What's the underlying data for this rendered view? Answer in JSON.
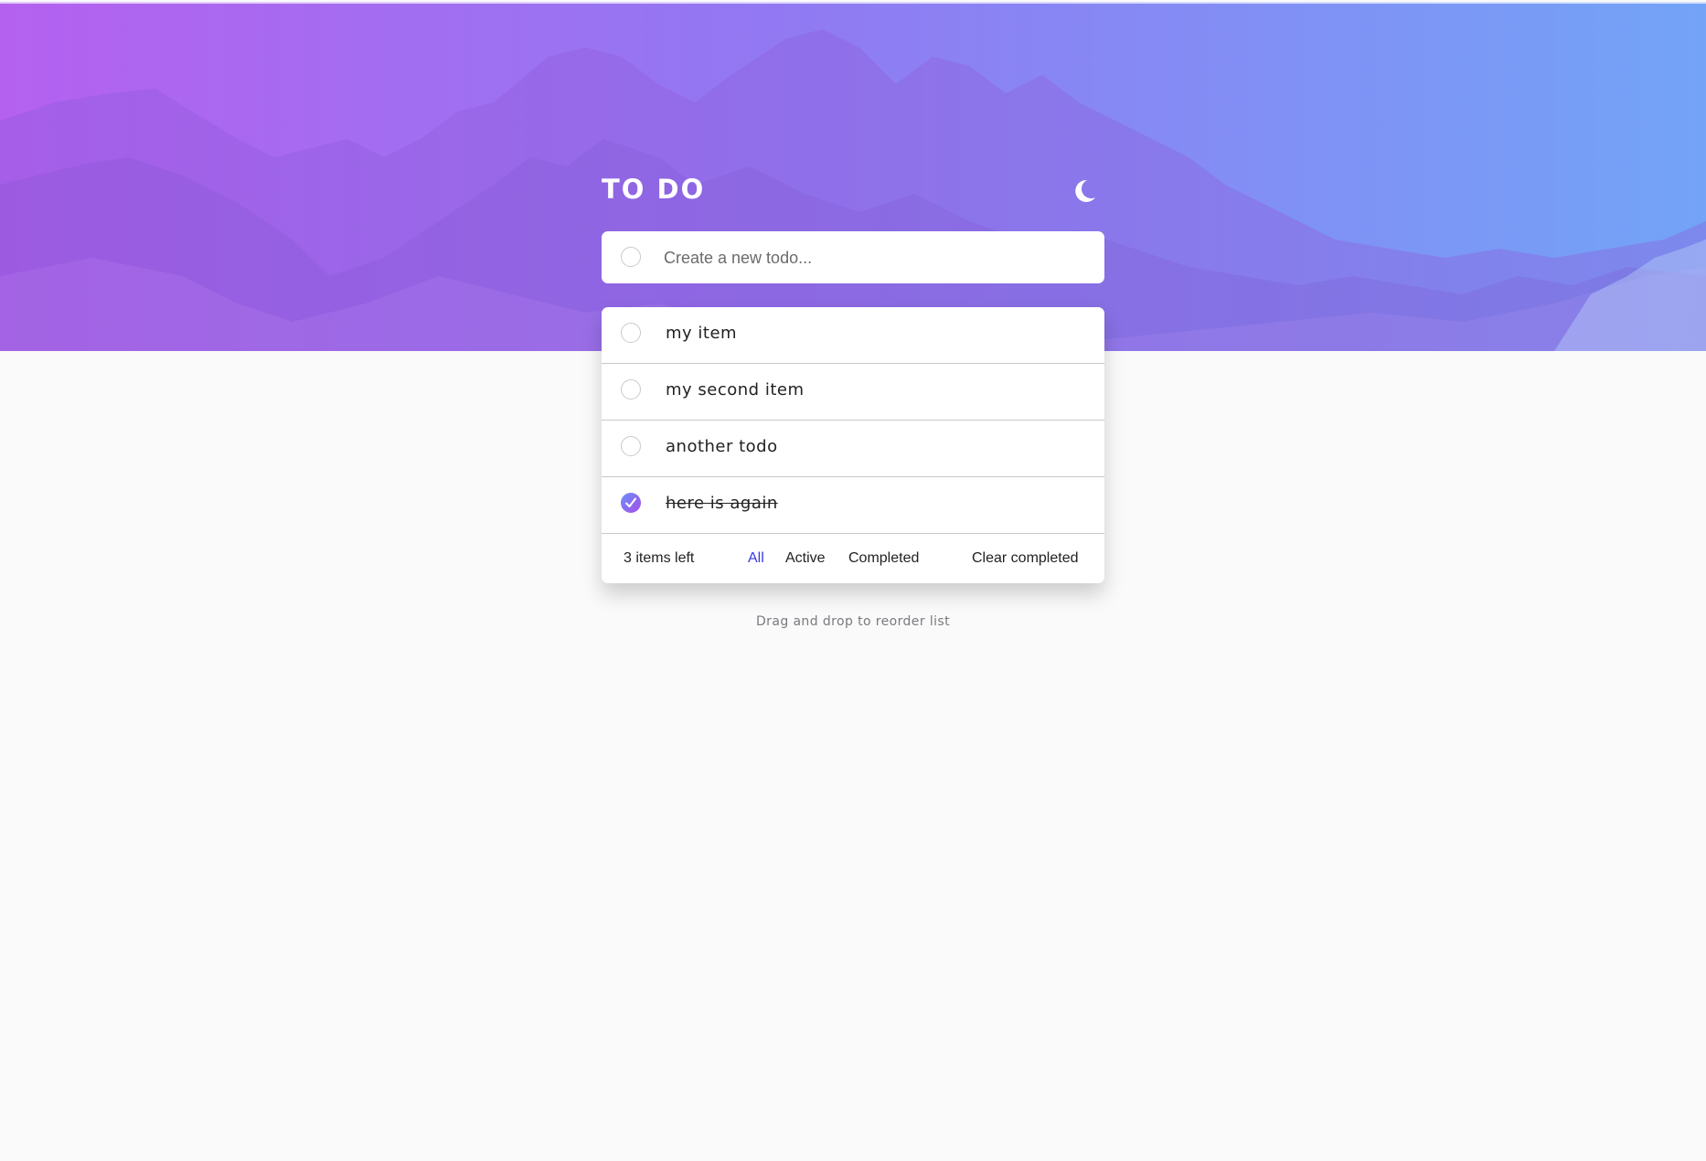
{
  "header": {
    "title": "TO DO",
    "theme_toggle_icon": "moon-icon"
  },
  "new_todo": {
    "placeholder": "Create a new todo...",
    "value": ""
  },
  "todos": [
    {
      "text": "my item",
      "completed": false
    },
    {
      "text": "my second item",
      "completed": false
    },
    {
      "text": "another todo",
      "completed": false
    },
    {
      "text": "here is again",
      "completed": true
    }
  ],
  "footer": {
    "items_left": "3 items left",
    "filters": {
      "all": "All",
      "active": "Active",
      "completed": "Completed"
    },
    "selected_filter": "All",
    "clear_completed": "Clear completed"
  },
  "hint": "Drag and drop to reorder list",
  "colors": {
    "gradient_start": "#b35ef0",
    "gradient_end": "#6fa0f6",
    "active_filter": "#3a3ae0",
    "background": "#fafafa"
  }
}
